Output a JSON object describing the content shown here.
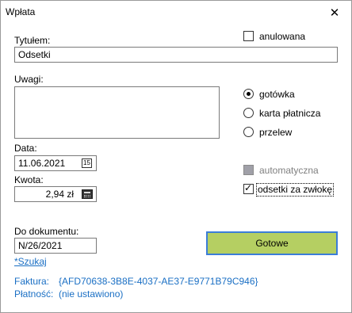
{
  "window": {
    "title": "Wpłata",
    "close_glyph": "✕"
  },
  "form": {
    "title_label": "Tytułem:",
    "title_value": "Odsetki",
    "notes_label": "Uwagi:",
    "notes_value": "",
    "date_label": "Data:",
    "date_value": "11.06.2021",
    "date_icon_text": "15",
    "amount_label": "Kwota:",
    "amount_value": "2,94 zł",
    "document_label": "Do dokumentu:",
    "document_value": "N/26/2021",
    "search_link": "*Szukaj"
  },
  "options": {
    "cancelled_label": "anulowana",
    "cancelled_checked": false,
    "payment_methods": [
      {
        "label": "gotówka",
        "selected": true
      },
      {
        "label": "karta płatnicza",
        "selected": false
      },
      {
        "label": "przelew",
        "selected": false
      }
    ],
    "automatic_label": "automatyczna",
    "late_interest_label": "odsetki za zwłokę",
    "late_interest_checked": true,
    "late_interest_check_glyph": "✓"
  },
  "actions": {
    "done_label": "Gotowe"
  },
  "info": {
    "invoice_label": "Faktura:",
    "invoice_value": "{AFD70638-3B8E-4037-AE37-E9771B79C946}",
    "payment_label": "Płatność:",
    "payment_value": "(nie ustawiono)"
  },
  "colors": {
    "done_button": "#b5cf62",
    "done_button_border": "#3b7dd8",
    "link": "#1a6fc4"
  }
}
